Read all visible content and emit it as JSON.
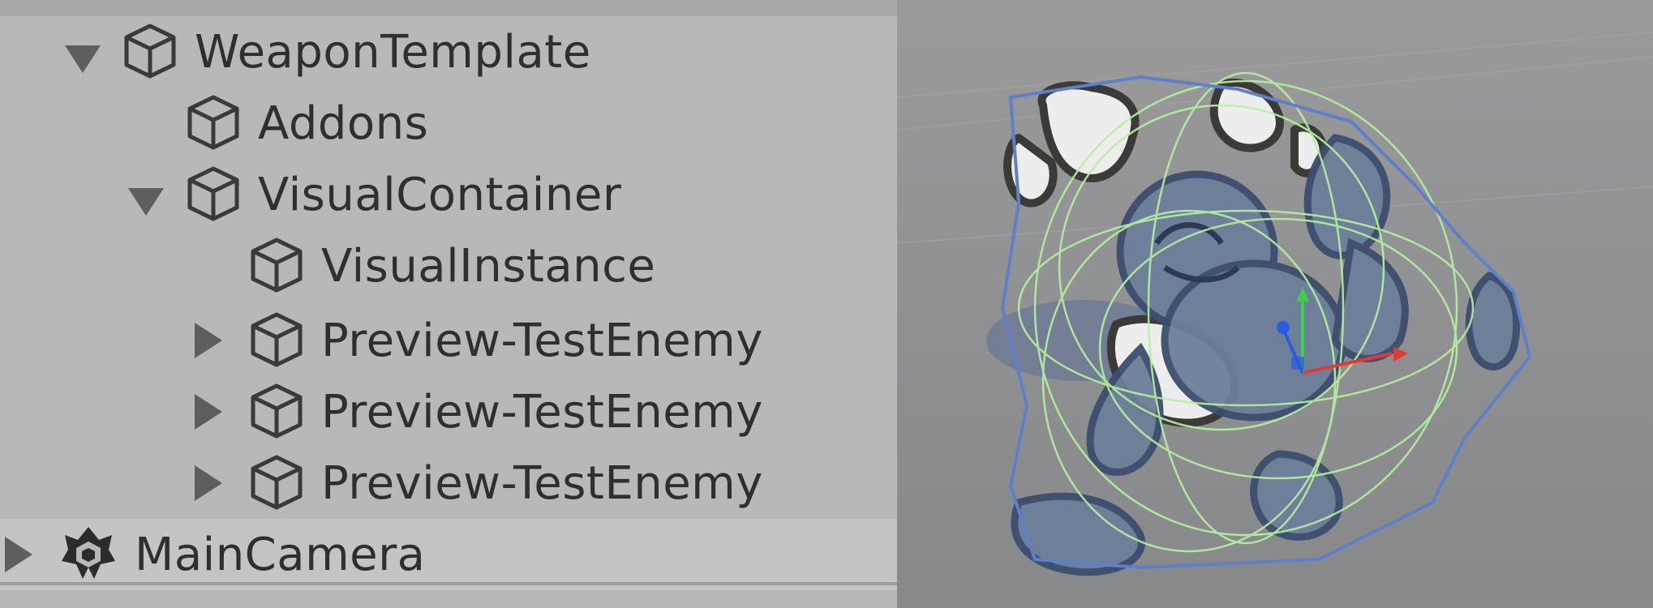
{
  "hierarchy": {
    "items": [
      {
        "label": "WeaponTemplate",
        "expanded": true,
        "icon": "cube-icon"
      },
      {
        "label": "Addons",
        "icon": "cube-icon"
      },
      {
        "label": "VisualContainer",
        "expanded": true,
        "icon": "cube-icon"
      },
      {
        "label": "VisualInstance",
        "icon": "cube-icon"
      },
      {
        "label": "Preview-TestEnemy",
        "expanded": false,
        "icon": "cube-icon"
      },
      {
        "label": "Preview-TestEnemy",
        "expanded": false,
        "icon": "cube-icon"
      },
      {
        "label": "Preview-TestEnemy",
        "expanded": false,
        "icon": "cube-icon"
      },
      {
        "label": "MainCamera",
        "expanded": false,
        "icon": "unity-camera-icon",
        "selected": true
      }
    ]
  },
  "scene": {
    "background_color": "#8f9092",
    "character_color": "#6d7f9a",
    "collider_color": "#b5f0a0",
    "bounds_color": "#5f7fc8",
    "gizmo": {
      "x_axis": "#e03a3a",
      "y_axis": "#3ad04a",
      "z_axis": "#2a5be0"
    }
  }
}
